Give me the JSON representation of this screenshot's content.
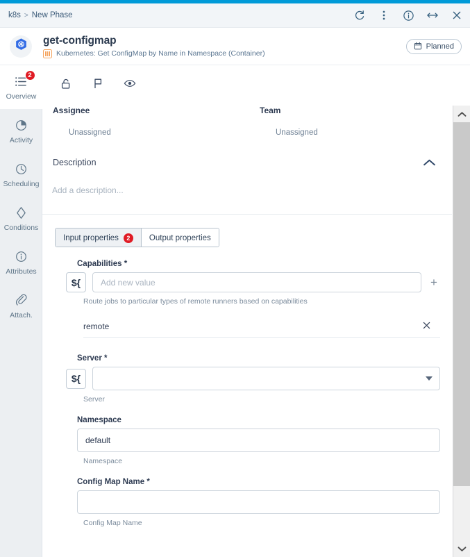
{
  "theme": {
    "accent": "#009ad8",
    "badge_red": "#e01b24",
    "text_dark": "#2e3b52",
    "text_muted": "#7b8b9c",
    "rail_bg": "#eceff2",
    "container_orange": "#f5a35c",
    "k8s_blue": "#326ce5"
  },
  "titlebar": {
    "breadcrumb": [
      "k8s",
      "New Phase"
    ],
    "separator": ">",
    "actions": [
      {
        "name": "refresh-icon",
        "label": "Refresh"
      },
      {
        "name": "more-vertical-icon",
        "label": "More actions"
      },
      {
        "name": "info-icon",
        "label": "Info"
      },
      {
        "name": "resize-horizontal-icon",
        "label": "Resize"
      },
      {
        "name": "close-icon",
        "label": "Close"
      }
    ]
  },
  "entity": {
    "avatar_icon": "kubernetes-logo-icon",
    "title": "get-configmap",
    "subtitle": "Kubernetes: Get ConfigMap by Name in Namespace (Container)",
    "subtitle_icon": "container-icon",
    "status": {
      "label": "Planned",
      "icon": "calendar-icon"
    }
  },
  "rail": {
    "items": [
      {
        "label": "Overview",
        "icon": "list-icon",
        "badge": "2",
        "active": true
      },
      {
        "label": "Activity",
        "icon": "pie-chart-icon",
        "badge": null,
        "active": false
      },
      {
        "label": "Scheduling",
        "icon": "clock-icon",
        "badge": null,
        "active": false
      },
      {
        "label": "Conditions",
        "icon": "diamond-icon",
        "badge": null,
        "active": false
      },
      {
        "label": "Attributes",
        "icon": "info-icon",
        "badge": null,
        "active": false
      },
      {
        "label": "Attach.",
        "icon": "paperclip-icon",
        "badge": null,
        "active": false
      }
    ]
  },
  "toolbar": {
    "actions": [
      {
        "name": "unlock-icon",
        "label": "Lock"
      },
      {
        "name": "flag-icon",
        "label": "Flag"
      },
      {
        "name": "eye-icon",
        "label": "Watch"
      }
    ]
  },
  "assignment": {
    "assignee_label": "Assignee",
    "assignee_value": "Unassigned",
    "team_label": "Team",
    "team_value": "Unassigned"
  },
  "description": {
    "title": "Description",
    "placeholder": "Add a description...",
    "collapse_icon": "chevron-up-icon",
    "expanded": true
  },
  "tabs": [
    {
      "label": "Input properties",
      "badge": "2",
      "active": true
    },
    {
      "label": "Output properties",
      "badge": null,
      "active": false
    }
  ],
  "properties": [
    {
      "name": "capabilities",
      "label": "Capabilities",
      "required": true,
      "expr_button": "${",
      "control": "multivalue",
      "value": "",
      "placeholder": "Add new value",
      "add_button": "+",
      "helper": "Route jobs to particular types of remote runners based on capabilities",
      "chips": [
        {
          "value": "remote",
          "remove_icon": "close-icon"
        }
      ]
    },
    {
      "name": "server",
      "label": "Server",
      "required": true,
      "expr_button": "${",
      "control": "select",
      "value": "",
      "placeholder": "",
      "helper": "Server",
      "caret_icon": "chevron-down-icon"
    },
    {
      "name": "namespace",
      "label": "Namespace",
      "required": false,
      "control": "text",
      "value": "default",
      "placeholder": "",
      "helper": "Namespace"
    },
    {
      "name": "config-map-name",
      "label": "Config Map Name",
      "required": true,
      "control": "text",
      "value": "",
      "placeholder": "",
      "helper": "Config Map Name"
    }
  ],
  "scrollbar": {
    "up_icon": "chevron-up-icon",
    "down_icon": "chevron-down-icon",
    "orientation": "vertical"
  }
}
